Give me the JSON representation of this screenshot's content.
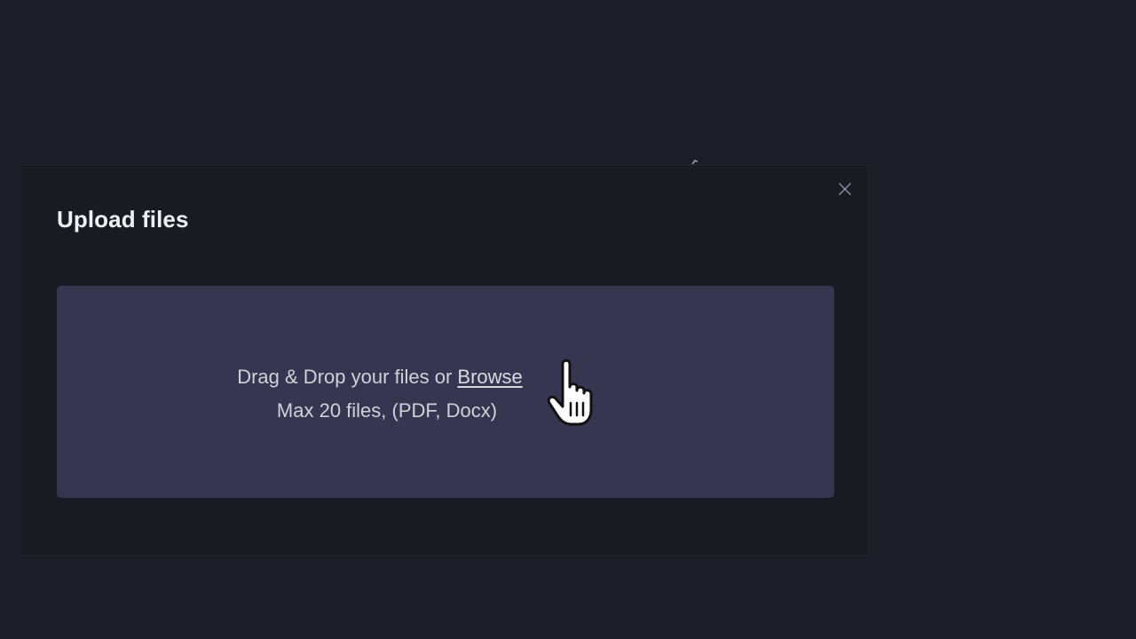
{
  "modal": {
    "title": "Upload files",
    "close_icon": "close-icon"
  },
  "dropzone": {
    "prefix_text": "Drag & Drop your files or ",
    "browse_label": "Browse",
    "hint_text": "Max 20 files, (PDF, Docx)"
  },
  "cursor": {
    "icon": "hand-pointer-icon"
  },
  "colors": {
    "background": "#1c1e27",
    "modal": "#191b23",
    "dropzone": "#363650",
    "title": "#eef0f4",
    "dropzone_text": "#cfd1da"
  }
}
